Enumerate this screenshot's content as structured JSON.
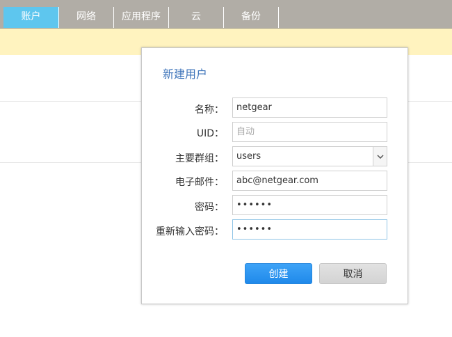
{
  "tabs": [
    {
      "label": "账户",
      "active": true
    },
    {
      "label": "网络",
      "active": false
    },
    {
      "label": "应用程序",
      "active": false
    },
    {
      "label": "云",
      "active": false
    },
    {
      "label": "备份",
      "active": false
    }
  ],
  "dialog": {
    "title": "新建用户",
    "fields": {
      "name": {
        "label": "名称：",
        "value": "netgear"
      },
      "uid": {
        "label": "UID：",
        "value": "",
        "placeholder": "自动"
      },
      "group": {
        "label": "主要群组：",
        "value": "users"
      },
      "email": {
        "label": "电子邮件：",
        "value": "abc@netgear.com"
      },
      "password": {
        "label": "密码：",
        "value": "••••••"
      },
      "confirm_password": {
        "label": "重新输入密码：",
        "value": "••••••"
      }
    },
    "buttons": {
      "create": "创建",
      "cancel": "取消"
    }
  },
  "colors": {
    "active_tab": "#5ec6ee",
    "tab_bar": "#b1ada6",
    "notice_bg": "#fff3bf",
    "primary_button": "#2d95f1",
    "title_text": "#3b72b9"
  },
  "icons": {
    "select_arrow": "chevron-down-icon"
  }
}
